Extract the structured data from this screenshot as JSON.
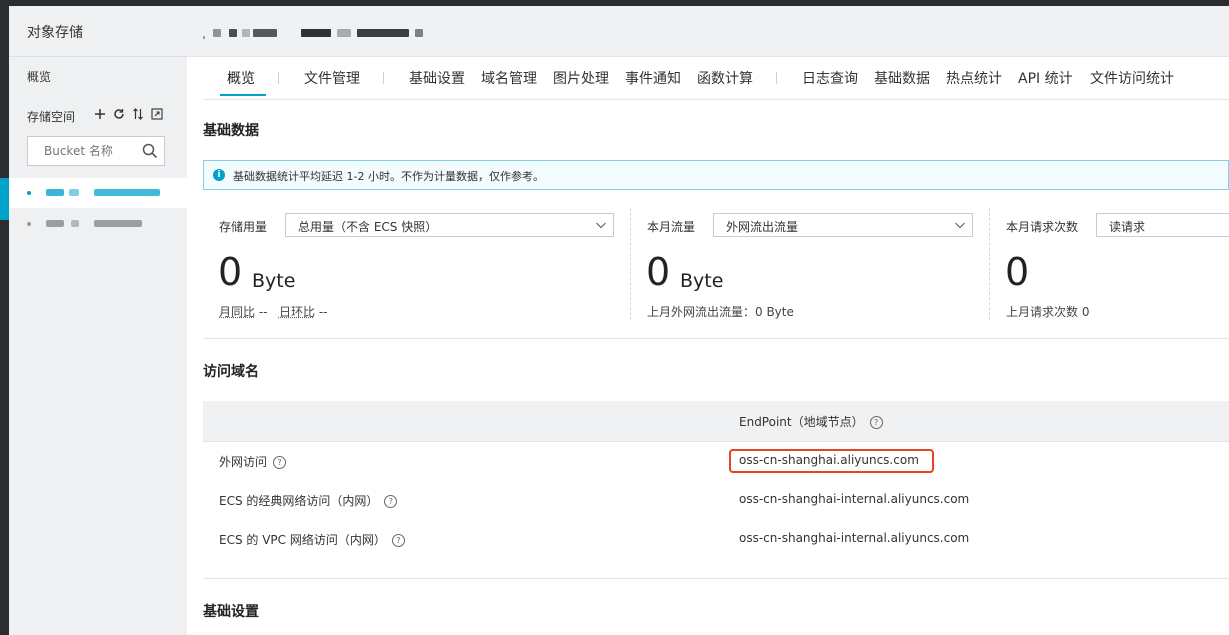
{
  "sidebar": {
    "title": "对象存储",
    "overview": "概览",
    "buckets_label": "存储空间",
    "search_placeholder": "Bucket 名称",
    "tool_icons": [
      "plus-icon",
      "refresh-icon",
      "sort-icon",
      "expand-icon"
    ]
  },
  "tabs": [
    "概览",
    "文件管理",
    "基础设置",
    "域名管理",
    "图片处理",
    "事件通知",
    "函数计算",
    "日志查询",
    "基础数据",
    "热点统计",
    "API 统计",
    "文件访问统计"
  ],
  "basic_data": {
    "title": "基础数据",
    "notice": "基础数据统计平均延迟 1-2 小时。不作为计量数据，仅作参考。",
    "storage": {
      "label": "存储用量",
      "select": "总用量（不含 ECS 快照）",
      "value": "0",
      "unit": "Byte",
      "mom": "月同比",
      "mom_val": "--",
      "dod": "日环比",
      "dod_val": "--"
    },
    "traffic": {
      "label": "本月流量",
      "select": "外网流出流量",
      "value": "0",
      "unit": "Byte",
      "sub": "上月外网流出流量：0 Byte"
    },
    "requests": {
      "label": "本月请求次数",
      "select": "读请求",
      "value": "0",
      "sub": "上月请求次数 0"
    }
  },
  "domains": {
    "title": "访问域名",
    "endpoint_header": "EndPoint（地域节点）",
    "rows": [
      {
        "label": "外网访问",
        "value": "oss-cn-shanghai.aliyuncs.com"
      },
      {
        "label": "ECS 的经典网络访问（内网）",
        "value": "oss-cn-shanghai-internal.aliyuncs.com"
      },
      {
        "label": "ECS 的 VPC 网络访问（内网）",
        "value": "oss-cn-shanghai-internal.aliyuncs.com"
      }
    ]
  },
  "basic_settings_title": "基础设置",
  "colors": {
    "accent": "#00a2ca",
    "highlight": "#e8431e",
    "sidebar_bg": "#eef0f2"
  }
}
